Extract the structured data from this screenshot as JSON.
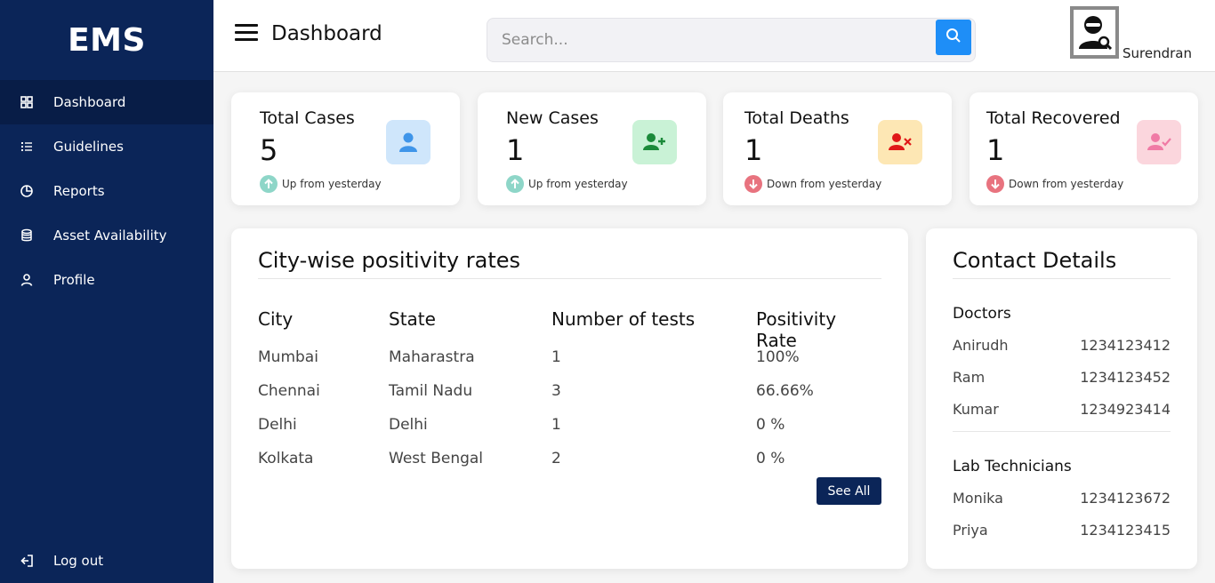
{
  "brand": "EMS",
  "sidebar": {
    "items": [
      {
        "label": "Dashboard",
        "icon": "grid-icon"
      },
      {
        "label": "Guidelines",
        "icon": "list-icon"
      },
      {
        "label": "Reports",
        "icon": "pie-chart-icon"
      },
      {
        "label": "Asset Availability",
        "icon": "database-icon"
      },
      {
        "label": "Profile",
        "icon": "user-icon"
      }
    ],
    "logout": "Log out"
  },
  "header": {
    "title": "Dashboard",
    "search_placeholder": "Search...",
    "username": "Surendran"
  },
  "stats": [
    {
      "label": "Total Cases",
      "value": "5",
      "trend": "Up from yesterday",
      "direction": "up",
      "icon": "user-icon",
      "tile_color": "#cfe6fb",
      "icon_color": "#3f95e9"
    },
    {
      "label": "New Cases",
      "value": "1",
      "trend": "Up from yesterday",
      "direction": "up",
      "icon": "user-plus-icon",
      "tile_color": "#c9f2d6",
      "icon_color": "#1b8a3a"
    },
    {
      "label": "Total Deaths",
      "value": "1",
      "trend": "Down from yesterday",
      "direction": "down",
      "icon": "user-x-icon",
      "tile_color": "#fde7b4",
      "icon_color": "#e01818"
    },
    {
      "label": "Total Recovered",
      "value": "1",
      "trend": "Down from yesterday",
      "direction": "down",
      "icon": "user-check-icon",
      "tile_color": "#fbd6dd",
      "icon_color": "#f07aa5"
    }
  ],
  "city_table": {
    "title": "City-wise positivity rates",
    "columns": [
      "City",
      "State",
      "Number of tests",
      "Positivity Rate"
    ],
    "rows": [
      [
        "Mumbai",
        "Maharastra",
        "1",
        "100%"
      ],
      [
        "Chennai",
        "Tamil Nadu",
        "3",
        "66.66%"
      ],
      [
        "Delhi",
        "Delhi",
        "1",
        "0 %"
      ],
      [
        "Kolkata",
        "West Bengal",
        "2",
        "0 %"
      ]
    ],
    "see_all": "See All"
  },
  "contacts": {
    "title": "Contact Details",
    "doctors_title": "Doctors",
    "doctors": [
      {
        "name": "Anirudh",
        "phone": "1234123412"
      },
      {
        "name": "Ram",
        "phone": "1234123452"
      },
      {
        "name": "Kumar",
        "phone": "1234923414"
      }
    ],
    "lab_title": "Lab Technicians",
    "lab": [
      {
        "name": "Monika",
        "phone": "1234123672"
      },
      {
        "name": "Priya",
        "phone": "1234123415"
      }
    ]
  },
  "colors": {
    "sidebar": "#0b2558",
    "accent": "#1e8ef7",
    "trend_up": "#8ed6c8",
    "trend_down": "#e8737f"
  }
}
